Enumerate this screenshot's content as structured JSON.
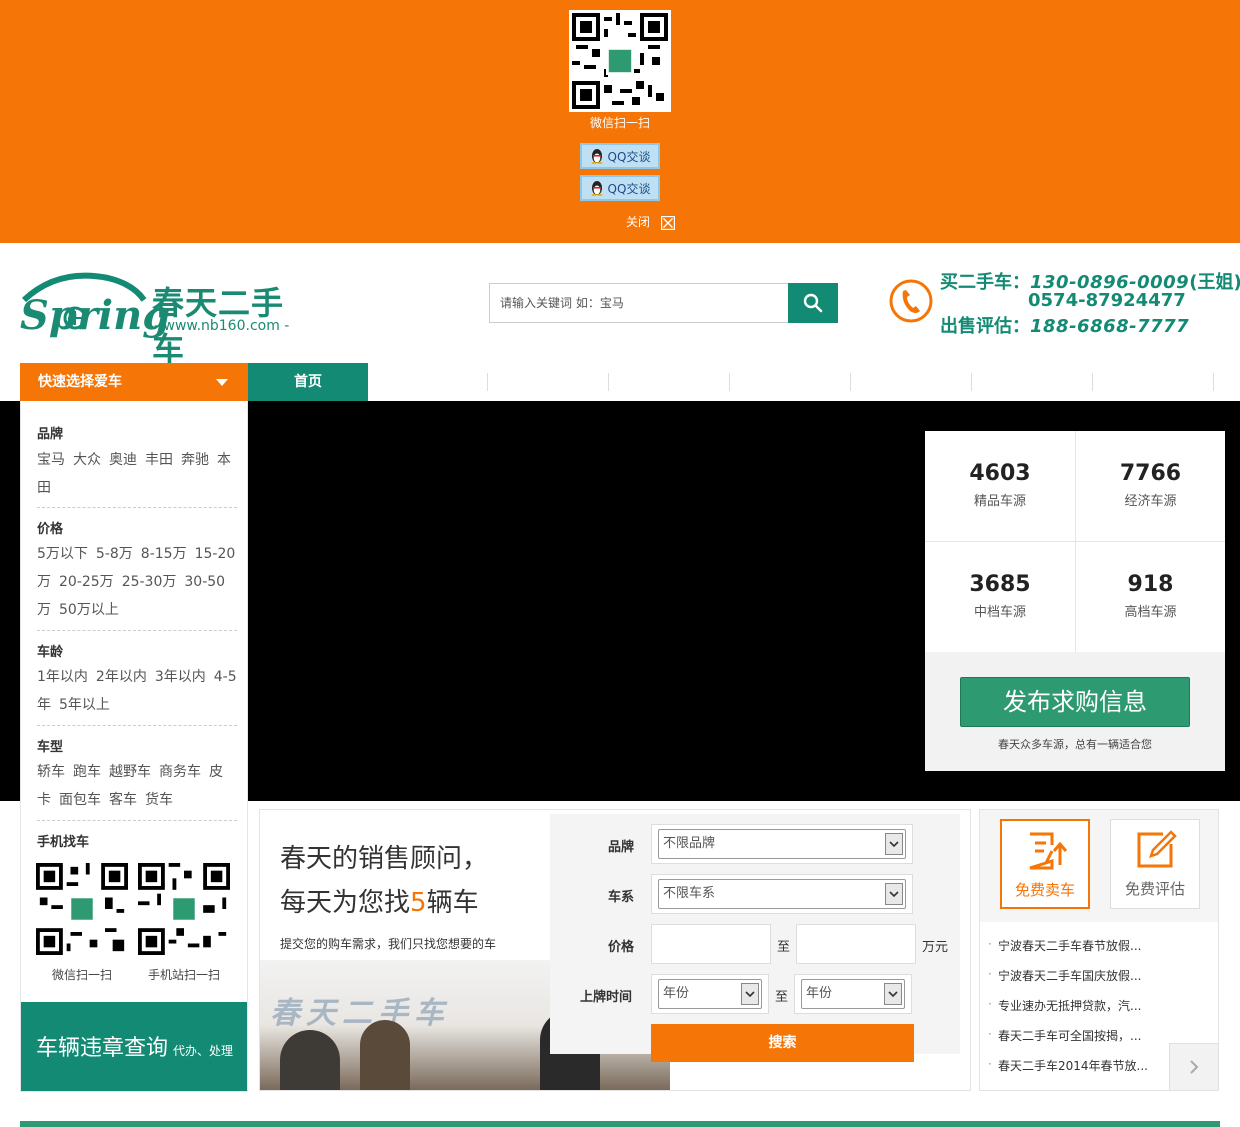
{
  "popup": {
    "qr_caption": "微信扫一扫",
    "qq_button_1": "QQ交谈",
    "qq_button_2": "QQ交谈",
    "close_label": "关闭"
  },
  "header": {
    "logo_cn": "春天二手车",
    "logo_en": "Spring",
    "logo_url": "- www.nb160.com -",
    "search_placeholder": "请输入关键词  如：宝马",
    "hotline_buy_label": "买二手车：",
    "hotline_buy_1": "130-0896-0009",
    "hotline_buy_1_name": "(王姐)",
    "hotline_buy_2": "0574-87924477",
    "hotline_sell_label": "出售评估：",
    "hotline_sell": "188-6868-7777"
  },
  "nav": {
    "quick_select": "快速选择爱车",
    "home": "首页"
  },
  "sidebar": {
    "brand_title": "品牌",
    "brands": [
      "宝马",
      "大众",
      "奥迪",
      "丰田",
      "奔驰",
      "本田"
    ],
    "price_title": "价格",
    "prices": [
      "5万以下",
      "5-8万",
      "8-15万",
      "15-20万",
      "20-25万",
      "25-30万",
      "30-50万",
      "50万以上"
    ],
    "age_title": "车龄",
    "ages": [
      "1年以内",
      "2年以内",
      "3年以内",
      "4-5年",
      "5年以上"
    ],
    "type_title": "车型",
    "types": [
      "轿车",
      "跑车",
      "越野车",
      "商务车",
      "皮卡",
      "面包车",
      "客车",
      "货车"
    ],
    "mobile_title": "手机找车",
    "qr1_caption": "微信扫一扫",
    "qr2_caption": "手机站扫一扫",
    "violation_big": "车辆违章查询",
    "violation_small": "代办、处理"
  },
  "stats": {
    "items": [
      {
        "num": "4603",
        "label": "精品车源"
      },
      {
        "num": "7766",
        "label": "经济车源"
      },
      {
        "num": "3685",
        "label": "中档车源"
      },
      {
        "num": "918",
        "label": "高档车源"
      }
    ],
    "publish_button": "发布求购信息",
    "publish_note": "春天众多车源，总有一辆适合您"
  },
  "consult": {
    "headline_1": "春天的销售顾问，",
    "headline_2a": "每天为您找",
    "headline_2b": "5",
    "headline_2c": "辆车",
    "subline": "提交您的购车需求，我们只找您想要的车",
    "banner_text": "春天二手车",
    "brand_label": "品牌",
    "brand_value": "不限品牌",
    "series_label": "车系",
    "series_value": "不限车系",
    "price_label": "价格",
    "to": "至",
    "unit": "万元",
    "reg_label": "上牌时间",
    "year": "年份",
    "year2": "年份",
    "to2": "至",
    "submit": "搜索"
  },
  "rightbox": {
    "sell_label": "免费卖车",
    "eval_label": "免费评估",
    "news": [
      "宁波春天二手车春节放假...",
      "宁波春天二手车国庆放假...",
      "专业速办无抵押贷款，汽...",
      "春天二手车可全国按揭，...",
      "春天二手车2014年春节放..."
    ]
  }
}
